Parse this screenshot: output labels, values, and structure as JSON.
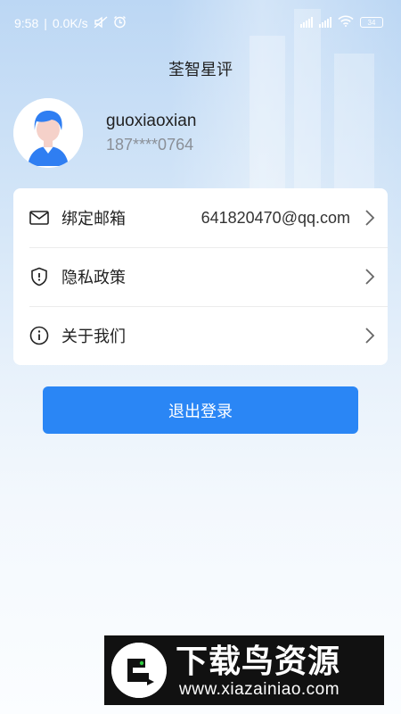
{
  "status_bar": {
    "time": "9:58",
    "network_speed": "0.0K/s",
    "separator": "|",
    "battery_level": "34",
    "icons": [
      "mute-icon",
      "alarm-icon",
      "signal-icon",
      "signal-icon",
      "wifi-icon",
      "battery-icon"
    ]
  },
  "app": {
    "title": "荃智星评"
  },
  "profile": {
    "username": "guoxiaoxian",
    "phone": "187****0764"
  },
  "menu": {
    "items": [
      {
        "label": "绑定邮箱",
        "value": "641820470@qq.com",
        "icon": "mail-icon"
      },
      {
        "label": "隐私政策",
        "value": "",
        "icon": "shield-icon"
      },
      {
        "label": "关于我们",
        "value": "",
        "icon": "info-icon"
      }
    ]
  },
  "logout": {
    "label": "退出登录"
  },
  "watermark": {
    "title": "下载鸟资源",
    "url": "www.xiazainiao.com"
  },
  "colors": {
    "accent": "#2a86f5",
    "background_top": "#bcd7f4",
    "text_primary": "#222222",
    "text_secondary": "#8a8f97"
  }
}
